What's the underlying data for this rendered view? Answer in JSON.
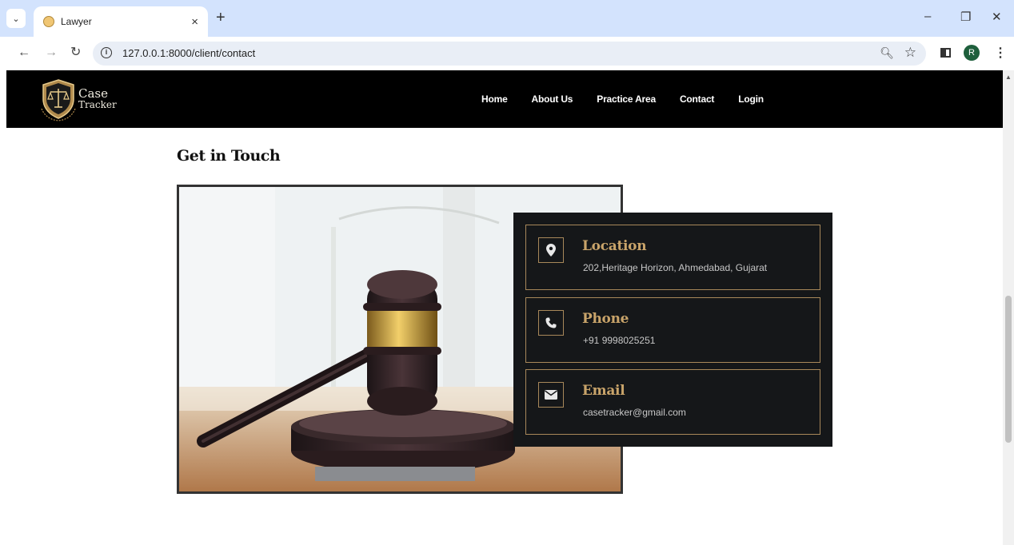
{
  "browser": {
    "tab_title": "Lawyer",
    "tab_close": "×",
    "new_tab": "+",
    "url": "127.0.0.1:8000/client/contact",
    "avatar_letter": "R",
    "window_controls": [
      "–",
      "❐",
      "✕"
    ]
  },
  "site": {
    "logo": {
      "line1": "Case",
      "line2": "Tracker"
    },
    "menu": [
      "Home",
      "About Us",
      "Practice Area",
      "Contact",
      "Login"
    ]
  },
  "contact": {
    "heading": "Get in Touch",
    "cards": [
      {
        "title": "Location",
        "value": "202,Heritage Horizon, Ahmedabad, Gujarat",
        "icon": "map-pin-icon"
      },
      {
        "title": "Phone",
        "value": "+91 9998025251",
        "icon": "phone-icon"
      },
      {
        "title": "Email",
        "value": "casetracker@gmail.com",
        "icon": "envelope-icon"
      }
    ]
  },
  "colors": {
    "accent_gold": "#c9a46a",
    "panel_bg": "#151719",
    "nav_bg": "#000000",
    "chrome_bg": "#d3e3fd"
  }
}
